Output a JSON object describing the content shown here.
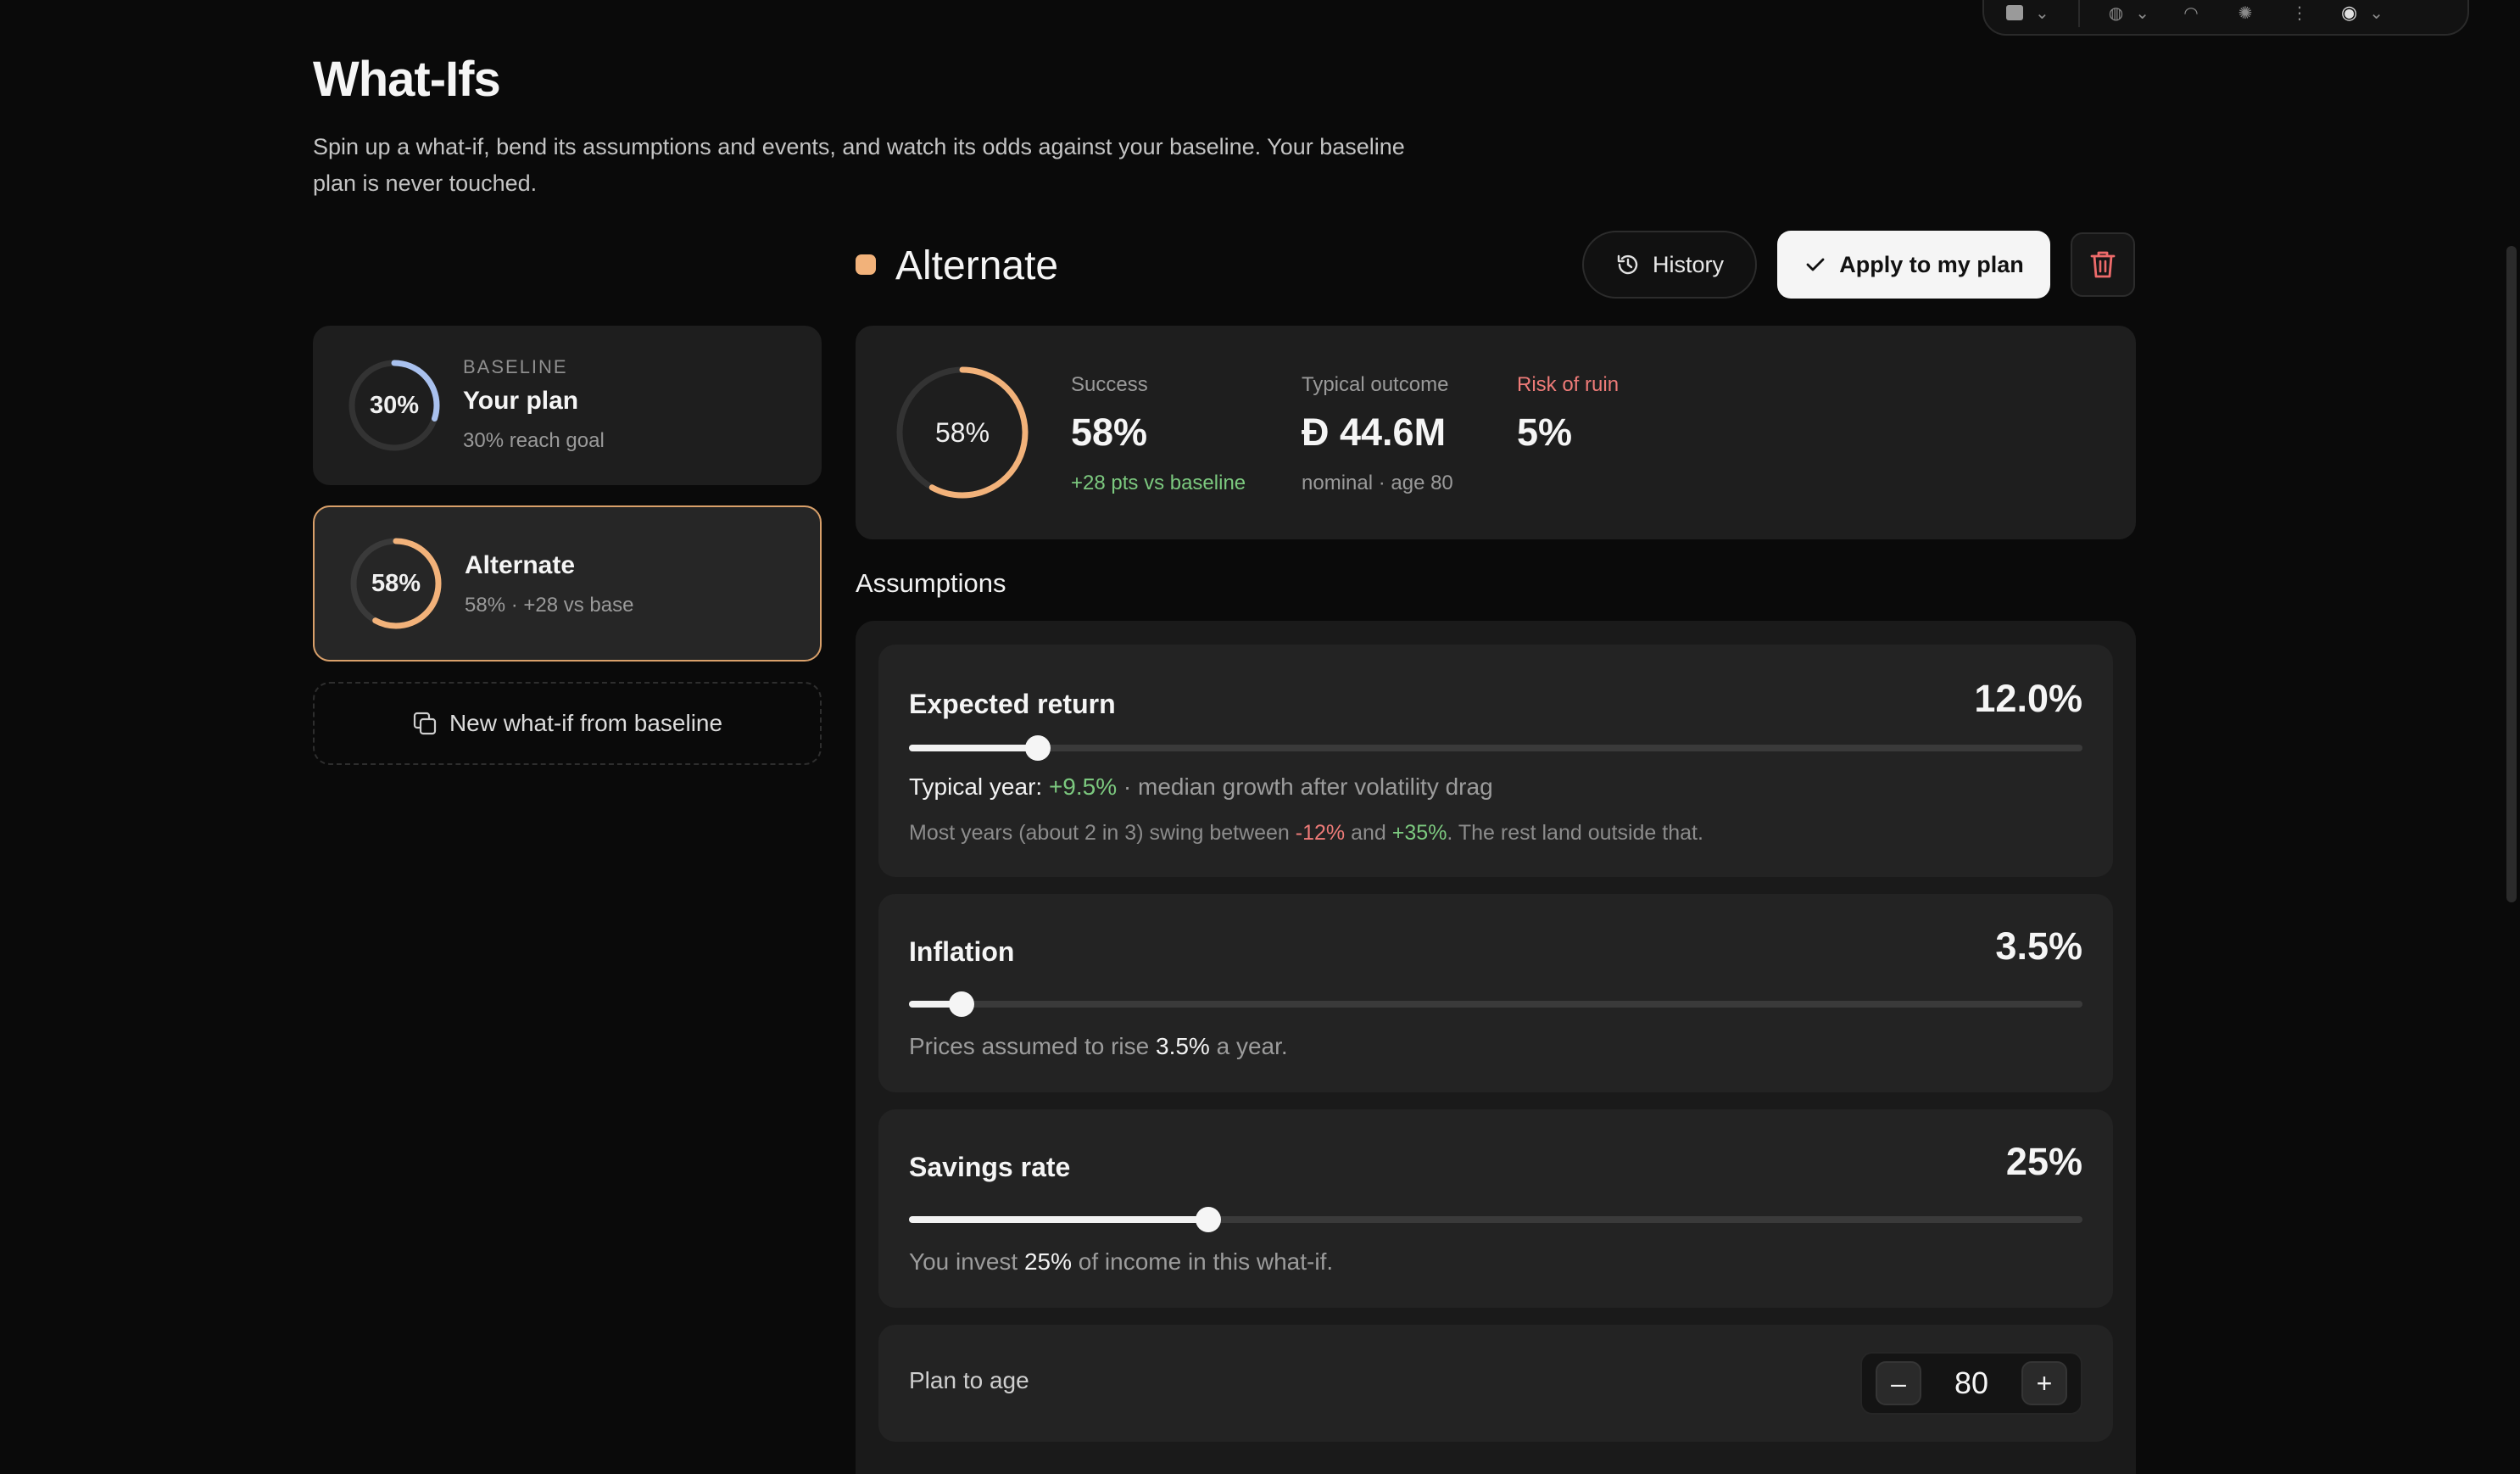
{
  "page": {
    "title": "What-Ifs",
    "description": "Spin up a what-if, bend its assumptions and events, and watch its odds against your baseline. Your baseline plan is never touched."
  },
  "scenarios": {
    "baseline": {
      "eyebrow": "BASELINE",
      "name": "Your plan",
      "pct_label": "30%",
      "success": 0.3,
      "sub": "30% reach goal",
      "color": "#a9c1ee"
    },
    "alternate": {
      "name": "Alternate",
      "pct_label": "58%",
      "success": 0.58,
      "sub": "58% · +28 vs base",
      "color": "#f2b27a"
    },
    "new_button": "New what-if from baseline"
  },
  "selected": {
    "name": "Alternate",
    "color": "#f2b27a",
    "history_label": "History",
    "apply_label": "Apply to my plan"
  },
  "stats": {
    "ring_label": "58%",
    "success_ratio": 0.58,
    "success": {
      "label": "Success",
      "value": "58%",
      "sub": "+28 pts vs baseline"
    },
    "typical": {
      "label": "Typical outcome",
      "value": "Ɖ 44.6M",
      "sub": "nominal · age 80"
    },
    "ruin": {
      "label": "Risk of ruin",
      "value": "5%"
    }
  },
  "assumptions": {
    "label": "Assumptions",
    "expected_return": {
      "title": "Expected return",
      "value": "12.0%",
      "slider_fraction": 0.11,
      "typical_prefix": "Typical year: ",
      "typical_value": "+9.5%",
      "typical_suffix": " · median growth after volatility drag",
      "range_prefix": "Most years (about 2 in 3) swing between ",
      "range_low": "-12%",
      "range_and": " and ",
      "range_high": "+35%",
      "range_suffix": ". The rest land outside that."
    },
    "inflation": {
      "title": "Inflation",
      "value": "3.5%",
      "slider_fraction": 0.045,
      "line_prefix": "Prices assumed to rise ",
      "line_value": "3.5%",
      "line_suffix": " a year."
    },
    "savings": {
      "title": "Savings rate",
      "value": "25%",
      "slider_fraction": 0.255,
      "line_prefix": "You invest ",
      "line_value": "25%",
      "line_suffix": " of income in this what-if."
    },
    "plan_age": {
      "label": "Plan to age",
      "value": "80",
      "minus": "–",
      "plus": "+"
    }
  },
  "colors": {
    "accent": "#f2b27a",
    "baseline_ring": "#a9c1ee",
    "positive": "#7cc97f",
    "negative": "#ee7b78"
  }
}
